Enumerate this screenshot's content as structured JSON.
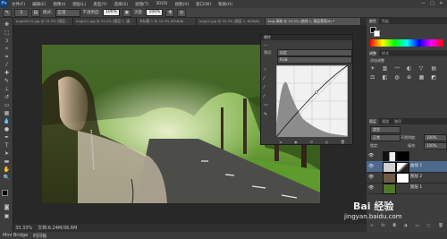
{
  "menubar": {
    "app_logo": "Ps",
    "items": [
      "文件(F)",
      "编辑(E)",
      "图像(I)",
      "图层(L)",
      "类型(Y)",
      "选择(S)",
      "滤镜(T)",
      "3D(D)",
      "视图(V)",
      "窗口(W)",
      "帮助(H)"
    ],
    "win_controls": [
      "—",
      "□",
      "✕"
    ]
  },
  "options": {
    "brush_size": "1",
    "mode_label": "模式:",
    "mode_value": "正常",
    "opacity_label": "不透明度:",
    "opacity_value": "100%",
    "flow_label": "流量:",
    "flow_value": "100%"
  },
  "tabs": [
    "Img00510.jpg @ 33.3% (图层...",
    "Img011.jpg @ 33.3% (图层 1, 通...",
    "未标题-1 @ 33.3% (RGB/8)",
    "Img11.jpg @ 33.3% (图层 1, RGB/8)",
    "Img 清晰 @ 33.3% (曲线 1, 图层蒙版/8) *"
  ],
  "curves": {
    "title": "属性",
    "preset_label": "预设:",
    "preset_value": "自定",
    "channel_value": "RGB"
  },
  "right": {
    "color_tabs": [
      "颜色",
      "色板"
    ],
    "adjust_tabs": [
      "调整",
      "样式"
    ],
    "adjust_title": "添加调整",
    "layers_tabs": [
      "图层",
      "通道",
      "路径"
    ],
    "kind_value": "类型",
    "blend_value": "正常",
    "opacity_label": "不透明度:",
    "opacity_value": "100%",
    "lock_label": "锁定:",
    "fill_label": "填充:",
    "fill_value": "100%",
    "layers": [
      "",
      "曲线 1",
      "图层 2",
      "图层 1"
    ]
  },
  "status": {
    "zoom": "33.33%",
    "doc": "文档:6.24M/36.6M"
  },
  "minibridge": {
    "items": [
      "Mini Bridge",
      "时间轴"
    ]
  },
  "watermark": {
    "site": "jingyan.baidu.com",
    "brand": "Bai 经验"
  },
  "colors": {
    "accent": "#4d6a8e"
  }
}
